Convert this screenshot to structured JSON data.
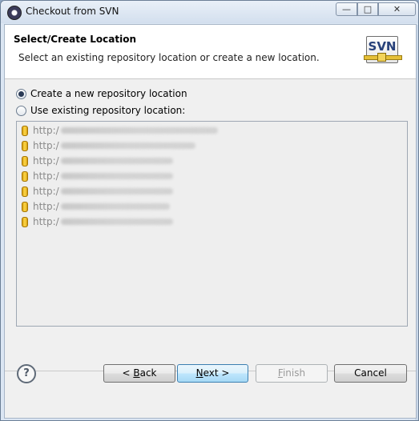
{
  "window": {
    "title": "Checkout from SVN",
    "controls": {
      "minimize": "—",
      "maximize": "□",
      "close": "✕"
    }
  },
  "header": {
    "title": "Select/Create Location",
    "description": "Select an existing repository location or create a new location.",
    "logo_text": "SVN"
  },
  "options": {
    "create_label": "Create a new repository location",
    "create_checked": true,
    "use_existing_label": "Use existing repository location:"
  },
  "locations": [
    {
      "prefix": "http:/"
    },
    {
      "prefix": "http:/"
    },
    {
      "prefix": "http:/"
    },
    {
      "prefix": "http:/"
    },
    {
      "prefix": "http:/"
    },
    {
      "prefix": "http:/"
    },
    {
      "prefix": "http:/"
    }
  ],
  "footer": {
    "help": "?",
    "back_pre": "< ",
    "back_key": "B",
    "back_post": "ack",
    "next_key": "N",
    "next_post": "ext >",
    "finish_key": "F",
    "finish_post": "inish",
    "cancel_label": "Cancel"
  },
  "colors": {
    "accent": "#3c7fb1",
    "list_background": "#eeeeee",
    "repo_icon": "#e6b41e"
  }
}
